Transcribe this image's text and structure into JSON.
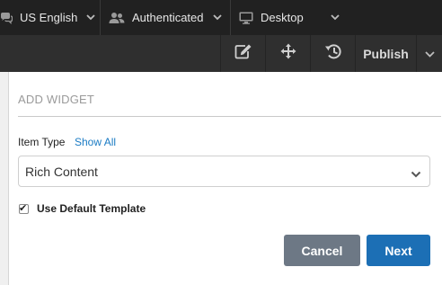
{
  "context_bar": {
    "language": {
      "label": "US English",
      "icon": "comments-icon"
    },
    "role": {
      "label": "Authenticated",
      "icon": "users-icon"
    },
    "device": {
      "label": "Desktop",
      "icon": "desktop-icon"
    }
  },
  "toolbar": {
    "icons": [
      "edit-icon",
      "move-icon",
      "history-icon"
    ],
    "publish_label": "Publish"
  },
  "panel": {
    "heading": "ADD WIDGET",
    "item_type_label": "Item Type",
    "show_all_link": "Show All",
    "item_type_select": {
      "value": "Rich Content"
    },
    "use_default_template": {
      "label": "Use Default Template",
      "checked": true
    },
    "cancel_label": "Cancel",
    "next_label": "Next"
  },
  "colors": {
    "topbar_bg": "#212121",
    "toolbar_bg": "#2f2f2f",
    "link": "#1a7bc4",
    "cancel_button": "#6d7885",
    "next_button": "#1c6fb5"
  }
}
